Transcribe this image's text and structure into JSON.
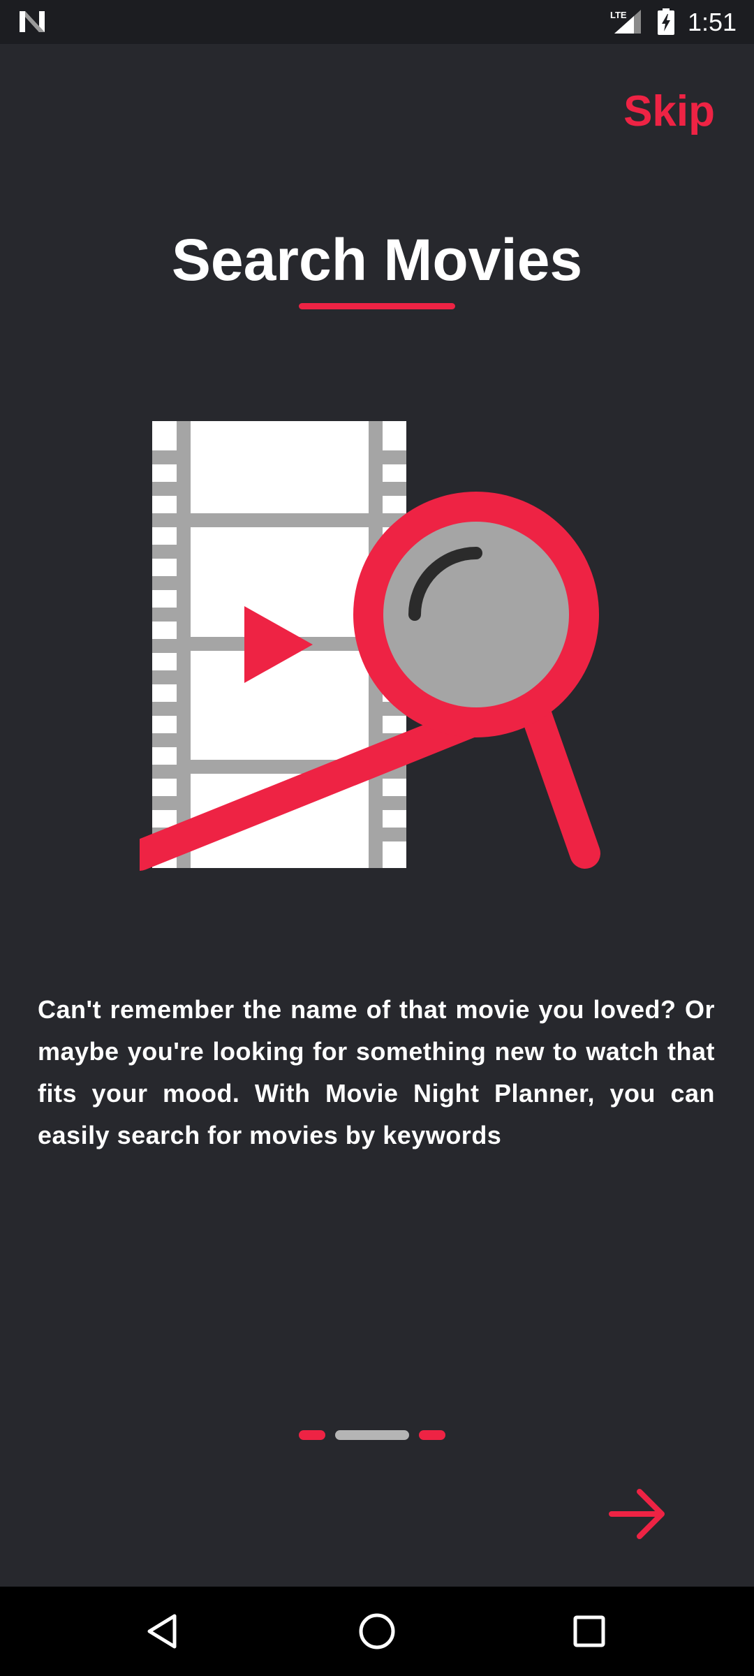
{
  "status_bar": {
    "time": "1:51",
    "network_label": "LTE",
    "icons": [
      "n-logo-icon",
      "lte-signal-icon",
      "battery-charging-icon"
    ]
  },
  "header": {
    "skip_label": "Skip"
  },
  "main": {
    "title": "Search Movies",
    "illustration_icons": [
      "film-strip-icon",
      "play-icon",
      "magnifying-glass-icon"
    ],
    "description": "Can't remember the name of that movie you loved? Or maybe you're looking for something new to watch that fits your mood. With Movie Night Planner, you can easily search for movies by keywords"
  },
  "pager": {
    "current_page": 2,
    "total_pages": 3
  },
  "footer": {
    "next_icon": "arrow-right-icon"
  },
  "nav_bar": {
    "icons": [
      "back-icon",
      "home-icon",
      "recents-icon"
    ]
  },
  "colors": {
    "background": "#27282d",
    "accent": "#ee2344",
    "status_bar": "#1c1d21",
    "indicator_active": "#b5b5b5",
    "film_gray": "#a5a5a5",
    "nav_bar": "#000000"
  }
}
